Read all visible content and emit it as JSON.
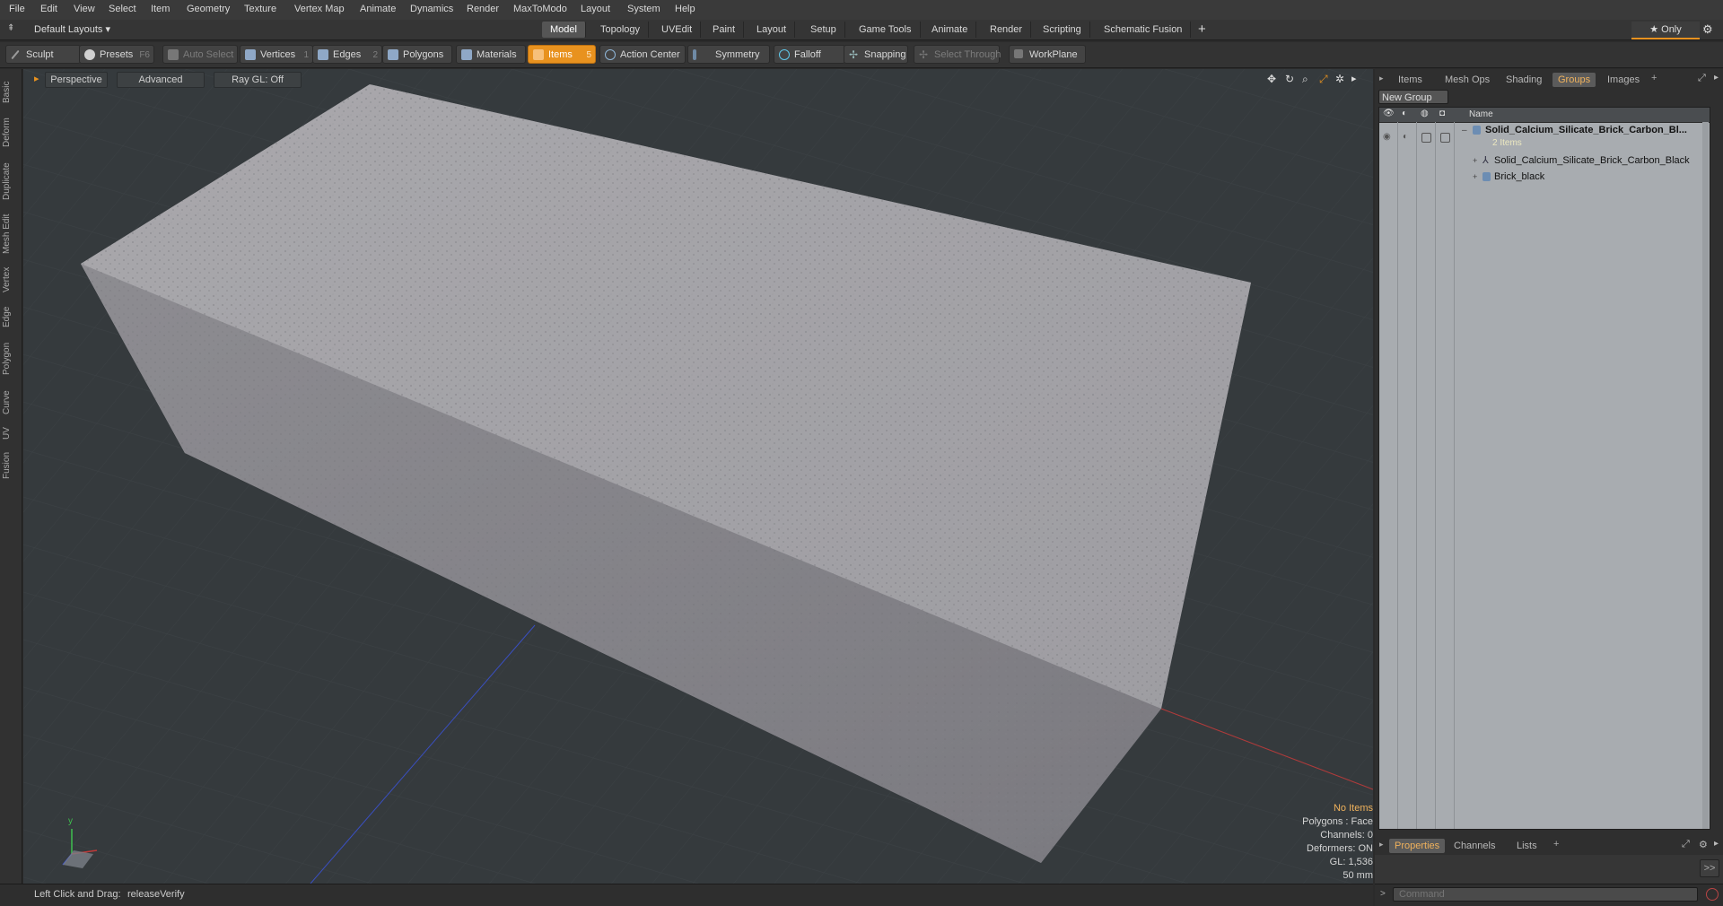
{
  "menu": [
    "File",
    "Edit",
    "View",
    "Select",
    "Item",
    "Geometry",
    "Texture",
    "Vertex Map",
    "Animate",
    "Dynamics",
    "Render",
    "MaxToModo",
    "Layout",
    "System",
    "Help"
  ],
  "layout": {
    "preset_label": "Default Layouts ▾",
    "tabs": [
      "Model",
      "Topology",
      "UVEdit",
      "Paint",
      "Layout",
      "Setup",
      "Game Tools",
      "Animate",
      "Render",
      "Scripting",
      "Schematic Fusion"
    ],
    "active_tab": "Model",
    "add_label": "+",
    "only_label": "★ Only",
    "gear_label": "⚙"
  },
  "toolbar": {
    "sculpt": "Sculpt",
    "presets": "Presets",
    "presets_key": "F6",
    "auto_select": "Auto Select",
    "vertices": "Vertices",
    "vertices_key": "1",
    "edges": "Edges",
    "edges_key": "2",
    "polygons": "Polygons",
    "materials": "Materials",
    "items": "Items",
    "items_key": "5",
    "action_center": "Action Center",
    "symmetry": "Symmetry",
    "falloff": "Falloff",
    "snapping": "Snapping",
    "select_through": "Select Through",
    "workplane": "WorkPlane"
  },
  "left_tabs": [
    "Basic",
    "Deform",
    "Duplicate",
    "Mesh Edit",
    "Vertex",
    "Edge",
    "Polygon",
    "Curve",
    "UV",
    "Fusion"
  ],
  "viewport": {
    "view": "Perspective",
    "shading": "Advanced",
    "raygl": "Ray GL: Off",
    "hud": [
      "No Items",
      "Polygons : Face",
      "Channels: 0",
      "Deformers: ON",
      "GL: 1,536",
      "50 mm"
    ],
    "axis_y": "y"
  },
  "right_panel": {
    "tabs": [
      "Items",
      "Mesh Ops",
      "Shading",
      "Groups",
      "Images"
    ],
    "active_tab": "Groups",
    "add_label": "+",
    "new_group": "New Group",
    "col_name": "Name",
    "group_name": "Solid_Calcium_Silicate_Brick_Carbon_Bl...",
    "group_count": "2 Items",
    "children": [
      "Solid_Calcium_Silicate_Brick_Carbon_Black",
      "Brick_black"
    ],
    "bottom_tabs": [
      "Properties",
      "Channels",
      "Lists"
    ],
    "bottom_active": "Properties",
    "expand_label": ">>",
    "command_placeholder": "Command"
  },
  "status": {
    "label": "Left Click and Drag:",
    "value": "releaseVerify"
  },
  "colors": {
    "accent": "#e8921f",
    "x_axis": "#c23a3a",
    "z_axis": "#3a4fc2"
  }
}
